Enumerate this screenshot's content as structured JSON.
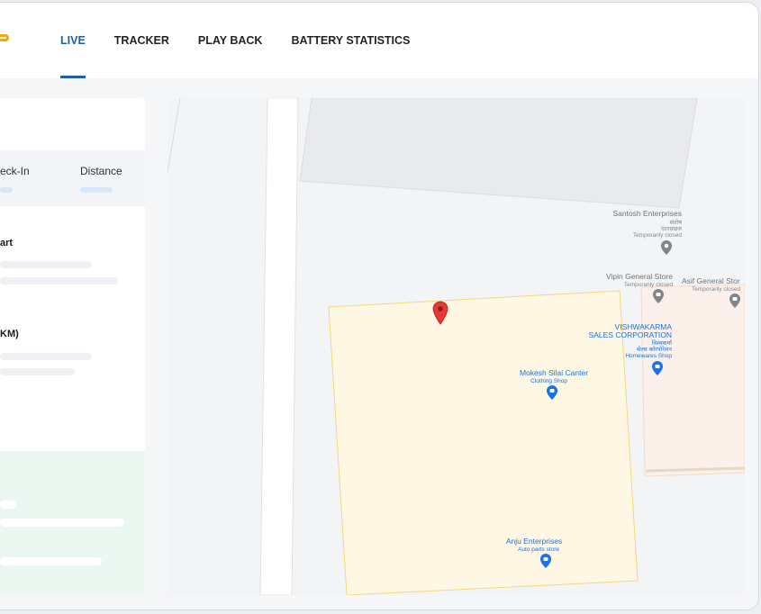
{
  "nav": {
    "tabs": [
      {
        "label": "LIVE",
        "active": true
      },
      {
        "label": "TRACKER",
        "active": false
      },
      {
        "label": "PLAY BACK",
        "active": false
      },
      {
        "label": "BATTERY STATISTICS",
        "active": false
      }
    ]
  },
  "panel": {
    "col_checkin_label": "eck-In",
    "col_distance_label": "Distance",
    "section_start_label": "art",
    "section_km_label": "KM)"
  },
  "map": {
    "pois": {
      "santosh": {
        "title": "Santosh Enterprises",
        "sub1": "संतोष",
        "sub2": "एंटरप्राइज",
        "status": "Temporarily closed"
      },
      "vipin": {
        "title": "Vipin General Store",
        "status": "Temporarily closed"
      },
      "asif": {
        "title": "Asif General Stor",
        "status": "Temporarily closed"
      },
      "vishwakarma": {
        "title1": "VISHWAKARMA",
        "title2": "SALES CORPORATION",
        "sub1": "विश्वकर्मा",
        "sub2": "सेल्स कॉरपोरेशन",
        "category": "Homewares Shop"
      },
      "mokesh": {
        "title": "Mokesh Silai Canter",
        "category": "Clothing Shop"
      },
      "anju": {
        "title": "Anju Enterprises",
        "category": "Auto parts store"
      }
    }
  },
  "colors": {
    "accent": "#1f5fa8",
    "brand": "#f2a900",
    "marker": "#e53935",
    "poi_blue": "#1a73e8",
    "poi_grey": "#80868b"
  }
}
